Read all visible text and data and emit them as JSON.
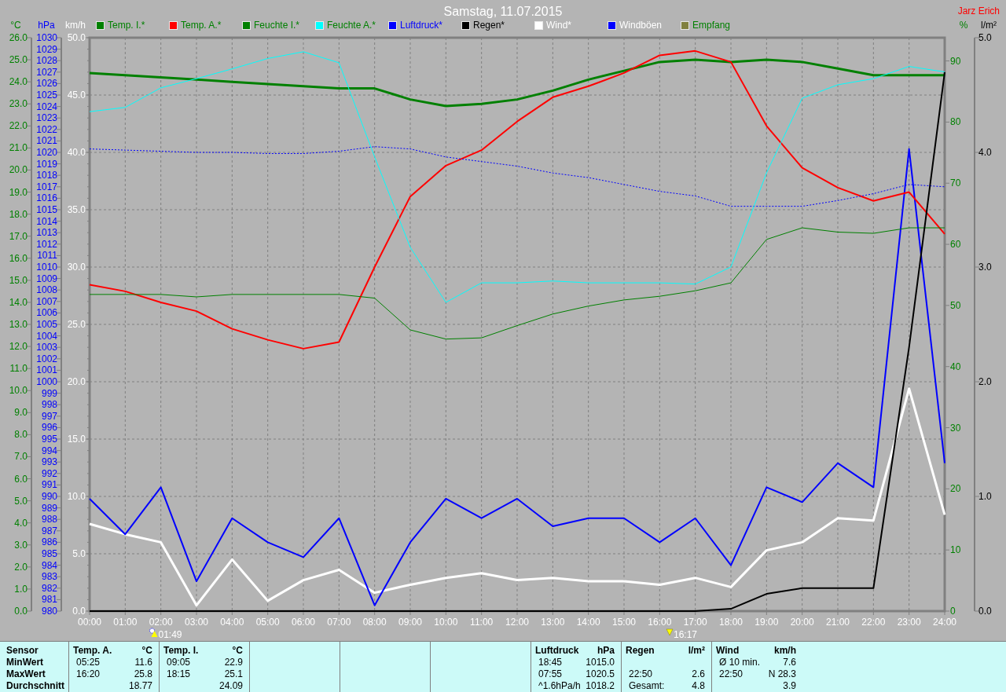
{
  "header": {
    "title": "Samstag, 11.07.2015",
    "user": "Jarz Erich"
  },
  "charts": [
    {
      "chart_data": {
        "type": "line",
        "ylabel": "km/h",
        "grid": true,
        "x": [
          0,
          1,
          2,
          3,
          4,
          5,
          6,
          7,
          8,
          9,
          10,
          11,
          12,
          13,
          14,
          15,
          16,
          17,
          18,
          19,
          20,
          21,
          22,
          23,
          24
        ],
        "xlim": [
          0,
          24
        ],
        "xticks": [
          {
            "value": 0,
            "label": "00:00"
          },
          {
            "value": 1,
            "label": "01:00"
          },
          {
            "value": 2,
            "label": "02:00"
          },
          {
            "value": 3,
            "label": "03:00"
          },
          {
            "value": 4,
            "label": "04:00"
          },
          {
            "value": 5,
            "label": "05:00"
          },
          {
            "value": 6,
            "label": "06:00"
          },
          {
            "value": 7,
            "label": "07:00"
          },
          {
            "value": 8,
            "label": "08:00"
          },
          {
            "value": 9,
            "label": "09:00"
          },
          {
            "value": 10,
            "label": "10:00"
          },
          {
            "value": 11,
            "label": "11:00"
          },
          {
            "value": 12,
            "label": "12:00"
          },
          {
            "value": 13,
            "label": "13:00"
          },
          {
            "value": 14,
            "label": "14:00"
          },
          {
            "value": 15,
            "label": "15:00"
          },
          {
            "value": 16,
            "label": "16:00"
          },
          {
            "value": 17,
            "label": "17:00"
          },
          {
            "value": 18,
            "label": "18:00"
          },
          {
            "value": 19,
            "label": "19:00"
          },
          {
            "value": 20,
            "label": "20:00"
          },
          {
            "value": 21,
            "label": "21:00"
          },
          {
            "value": 22,
            "label": "22:00"
          },
          {
            "value": 23,
            "label": "23:00"
          },
          {
            "value": 24,
            "label": "24:00"
          }
        ],
        "ylim": [
          0,
          50
        ],
        "yticks": [
          {
            "value": 50,
            "label": "50.0"
          },
          {
            "value": 45,
            "label": "45.0"
          },
          {
            "value": 40,
            "label": "40.0"
          },
          {
            "value": 35,
            "label": "35.0"
          },
          {
            "value": 30,
            "label": "30.0"
          },
          {
            "value": 25,
            "label": "25.0"
          },
          {
            "value": 20,
            "label": "20.0"
          },
          {
            "value": 15,
            "label": "15.0"
          },
          {
            "value": 10,
            "label": "10.0"
          },
          {
            "value": 5,
            "label": "5.0"
          },
          {
            "value": 0,
            "label": "0.0"
          }
        ],
        "series": [
          {
            "name": "Wind*",
            "color": "#ffffff",
            "values": [
              7.6,
              6.7,
              6.0,
              0.5,
              4.5,
              0.9,
              2.7,
              3.6,
              1.6,
              2.3,
              2.9,
              3.3,
              2.7,
              2.9,
              2.6,
              2.6,
              2.3,
              2.9,
              2.1,
              5.3,
              6.0,
              8.1,
              7.9,
              19.4,
              8.4
            ]
          },
          {
            "name": "Windböen",
            "color": "#0000ff",
            "values": [
              9.8,
              6.7,
              10.8,
              2.6,
              8.1,
              6.0,
              4.7,
              8.1,
              0.5,
              6.0,
              9.8,
              8.1,
              9.8,
              7.4,
              8.1,
              8.1,
              6.0,
              8.1,
              4.0,
              10.8,
              9.5,
              12.9,
              10.8,
              40.3,
              12.9
            ]
          }
        ]
      }
    },
    {
      "chart_data": {
        "type": "line",
        "ylabel": "°C",
        "x": [
          0,
          1,
          2,
          3,
          4,
          5,
          6,
          7,
          8,
          9,
          10,
          11,
          12,
          13,
          14,
          15,
          16,
          17,
          18,
          19,
          20,
          21,
          22,
          23,
          24
        ],
        "xlim": [
          0,
          24
        ],
        "ylim": [
          0,
          26
        ],
        "yticks": [
          {
            "value": 26,
            "label": "26.0"
          },
          {
            "value": 25,
            "label": "25.0"
          },
          {
            "value": 24,
            "label": "24.0"
          },
          {
            "value": 23,
            "label": "23.0"
          },
          {
            "value": 22,
            "label": "22.0"
          },
          {
            "value": 21,
            "label": "21.0"
          },
          {
            "value": 20,
            "label": "20.0"
          },
          {
            "value": 19,
            "label": "19.0"
          },
          {
            "value": 18,
            "label": "18.0"
          },
          {
            "value": 17,
            "label": "17.0"
          },
          {
            "value": 16,
            "label": "16.0"
          },
          {
            "value": 15,
            "label": "15.0"
          },
          {
            "value": 14,
            "label": "14.0"
          },
          {
            "value": 13,
            "label": "13.0"
          },
          {
            "value": 12,
            "label": "12.0"
          },
          {
            "value": 11,
            "label": "11.0"
          },
          {
            "value": 10,
            "label": "10.0"
          },
          {
            "value": 9,
            "label": "9.0"
          },
          {
            "value": 8,
            "label": "8.0"
          },
          {
            "value": 7,
            "label": "7.0"
          },
          {
            "value": 6,
            "label": "6.0"
          },
          {
            "value": 5,
            "label": "5.0"
          },
          {
            "value": 4,
            "label": "4.0"
          },
          {
            "value": 3,
            "label": "3.0"
          },
          {
            "value": 2,
            "label": "2.0"
          },
          {
            "value": 1,
            "label": "1.0"
          },
          {
            "value": 0,
            "label": "0.0"
          }
        ],
        "series": [
          {
            "name": "Temp. I.*",
            "color": "#008000",
            "values": [
              24.4,
              24.3,
              24.2,
              24.1,
              24.0,
              23.9,
              23.8,
              23.7,
              23.7,
              23.2,
              22.9,
              23.0,
              23.2,
              23.6,
              24.1,
              24.5,
              24.9,
              25.0,
              24.9,
              25.0,
              24.9,
              24.6,
              24.3,
              24.3,
              24.3
            ]
          },
          {
            "name": "Temp. A.*",
            "color": "#ff0000",
            "values": [
              14.8,
              14.5,
              14.0,
              13.6,
              12.8,
              12.3,
              11.9,
              12.2,
              15.6,
              18.8,
              20.2,
              20.9,
              22.2,
              23.3,
              23.8,
              24.4,
              25.2,
              25.4,
              24.9,
              22.0,
              20.1,
              19.2,
              18.6,
              19.0,
              17.1
            ]
          }
        ]
      }
    },
    {
      "chart_data": {
        "type": "line",
        "ylabel": "hPa",
        "x": [
          0,
          1,
          2,
          3,
          4,
          5,
          6,
          7,
          8,
          9,
          10,
          11,
          12,
          13,
          14,
          15,
          16,
          17,
          18,
          19,
          20,
          21,
          22,
          23,
          24
        ],
        "xlim": [
          0,
          24
        ],
        "ylim": [
          980,
          1030
        ],
        "yticks": [
          {
            "value": 1030,
            "label": "1030"
          },
          {
            "value": 1029,
            "label": "1029"
          },
          {
            "value": 1028,
            "label": "1028"
          },
          {
            "value": 1027,
            "label": "1027"
          },
          {
            "value": 1026,
            "label": "1026"
          },
          {
            "value": 1025,
            "label": "1025"
          },
          {
            "value": 1024,
            "label": "1024"
          },
          {
            "value": 1023,
            "label": "1023"
          },
          {
            "value": 1022,
            "label": "1022"
          },
          {
            "value": 1021,
            "label": "1021"
          },
          {
            "value": 1020,
            "label": "1020"
          },
          {
            "value": 1019,
            "label": "1019"
          },
          {
            "value": 1018,
            "label": "1018"
          },
          {
            "value": 1017,
            "label": "1017"
          },
          {
            "value": 1016,
            "label": "1016"
          },
          {
            "value": 1015,
            "label": "1015"
          },
          {
            "value": 1014,
            "label": "1014"
          },
          {
            "value": 1013,
            "label": "1013"
          },
          {
            "value": 1012,
            "label": "1012"
          },
          {
            "value": 1011,
            "label": "1011"
          },
          {
            "value": 1010,
            "label": "1010"
          },
          {
            "value": 1009,
            "label": "1009"
          },
          {
            "value": 1008,
            "label": "1008"
          },
          {
            "value": 1007,
            "label": "1007"
          },
          {
            "value": 1006,
            "label": "1006"
          },
          {
            "value": 1005,
            "label": "1005"
          },
          {
            "value": 1004,
            "label": "1004"
          },
          {
            "value": 1003,
            "label": "1003"
          },
          {
            "value": 1002,
            "label": "1002"
          },
          {
            "value": 1001,
            "label": "1001"
          },
          {
            "value": 1000,
            "label": "1000"
          },
          {
            "value": 999,
            "label": "999"
          },
          {
            "value": 998,
            "label": "998"
          },
          {
            "value": 997,
            "label": "997"
          },
          {
            "value": 996,
            "label": "996"
          },
          {
            "value": 995,
            "label": "995"
          },
          {
            "value": 994,
            "label": "994"
          },
          {
            "value": 993,
            "label": "993"
          },
          {
            "value": 992,
            "label": "992"
          },
          {
            "value": 991,
            "label": "991"
          },
          {
            "value": 990,
            "label": "990"
          },
          {
            "value": 989,
            "label": "989"
          },
          {
            "value": 988,
            "label": "988"
          },
          {
            "value": 987,
            "label": "987"
          },
          {
            "value": 986,
            "label": "986"
          },
          {
            "value": 985,
            "label": "985"
          },
          {
            "value": 984,
            "label": "984"
          },
          {
            "value": 983,
            "label": "983"
          },
          {
            "value": 982,
            "label": "982"
          },
          {
            "value": 981,
            "label": "981"
          },
          {
            "value": 980,
            "label": "980"
          }
        ],
        "series": [
          {
            "name": "Luftdruck*",
            "color": "#0000ff",
            "line_style": "dotted",
            "values": [
              1020.3,
              1020.2,
              1020.1,
              1020.0,
              1020.0,
              1019.9,
              1019.9,
              1020.1,
              1020.5,
              1020.3,
              1019.6,
              1019.2,
              1018.8,
              1018.2,
              1017.8,
              1017.2,
              1016.6,
              1016.2,
              1015.3,
              1015.3,
              1015.3,
              1015.8,
              1016.4,
              1017.2,
              1017.0
            ]
          }
        ]
      }
    },
    {
      "chart_data": {
        "type": "line",
        "ylabel": "%",
        "x": [
          0,
          1,
          2,
          3,
          4,
          5,
          6,
          7,
          8,
          9,
          10,
          11,
          12,
          13,
          14,
          15,
          16,
          17,
          18,
          19,
          20,
          21,
          22,
          23,
          24
        ],
        "xlim": [
          0,
          24
        ],
        "ylim": [
          0,
          93.8
        ],
        "yticks": [
          {
            "value": 90,
            "label": "90"
          },
          {
            "value": 80,
            "label": "80"
          },
          {
            "value": 70,
            "label": "70"
          },
          {
            "value": 60,
            "label": "60"
          },
          {
            "value": 50,
            "label": "50"
          },
          {
            "value": 40,
            "label": "40"
          },
          {
            "value": 30,
            "label": "30"
          },
          {
            "value": 20,
            "label": "20"
          },
          {
            "value": 10,
            "label": "10"
          },
          {
            "value": 0,
            "label": "0"
          }
        ],
        "series": [
          {
            "name": "Feuchte I.*",
            "color": "#008000",
            "values": [
              51.8,
              51.8,
              51.8,
              51.4,
              51.8,
              51.8,
              51.8,
              51.8,
              51.2,
              46.0,
              44.5,
              44.7,
              46.7,
              48.6,
              49.9,
              50.9,
              51.5,
              52.4,
              53.7,
              60.8,
              62.7,
              62.0,
              61.8,
              62.7,
              62.7
            ]
          },
          {
            "name": "Feuchte A.*",
            "color": "#00ffff",
            "values": [
              81.7,
              82.4,
              85.6,
              87.1,
              88.7,
              90.4,
              91.5,
              89.7,
              74.3,
              59.5,
              50.5,
              53.7,
              53.7,
              54.0,
              53.7,
              53.7,
              53.7,
              53.5,
              56.3,
              71.7,
              83.9,
              86.1,
              87.1,
              89.1,
              88.2
            ]
          }
        ]
      }
    },
    {
      "chart_data": {
        "type": "line",
        "ylabel": "l/m²",
        "x": [
          0,
          1,
          2,
          3,
          4,
          5,
          6,
          7,
          8,
          9,
          10,
          11,
          12,
          13,
          14,
          15,
          16,
          17,
          18,
          19,
          20,
          21,
          22,
          23,
          24
        ],
        "xlim": [
          0,
          24
        ],
        "ylim": [
          0,
          5
        ],
        "yticks": [
          {
            "value": 5,
            "label": "5.0"
          },
          {
            "value": 4,
            "label": "4.0"
          },
          {
            "value": 3,
            "label": "3.0"
          },
          {
            "value": 2,
            "label": "2.0"
          },
          {
            "value": 1,
            "label": "1.0"
          },
          {
            "value": 0,
            "label": "0.0"
          }
        ],
        "series": [
          {
            "name": "Regen*",
            "color": "#000000",
            "values": [
              0,
              0,
              0,
              0,
              0,
              0,
              0,
              0,
              0,
              0,
              0,
              0,
              0,
              0,
              0,
              0,
              0,
              0,
              0.02,
              0.15,
              0.2,
              0.2,
              0.2,
              2.3,
              4.7
            ]
          }
        ]
      }
    }
  ],
  "legend_extra": {
    "label": "Empfang",
    "color": "#808040"
  },
  "time_marks": [
    {
      "kind": "sun",
      "label": "01:49"
    },
    {
      "kind": "arrow",
      "label": "16:17"
    }
  ],
  "stats": {
    "labels": [
      "Sensor",
      "MinWert",
      "MaxWert",
      "Durchschnitt"
    ],
    "blocks": [
      {
        "kind": "data",
        "heading": "Temp. A.",
        "unit": "°C",
        "rows": [
          {
            "time": "05:25",
            "value": "11.6"
          },
          {
            "time": "16:20",
            "value": "25.8"
          },
          {
            "value": "18.77"
          }
        ]
      },
      {
        "kind": "data",
        "heading": "Temp. I.",
        "unit": "°C",
        "rows": [
          {
            "time": "09:05",
            "value": "22.9"
          },
          {
            "time": "18:15",
            "value": "25.1"
          },
          {
            "value": "24.09"
          }
        ]
      },
      {
        "kind": "empty"
      },
      {
        "kind": "empty"
      },
      {
        "kind": "empty"
      },
      {
        "kind": "data",
        "heading": "Luftdruck",
        "unit": "hPa",
        "rows": [
          {
            "time": "18:45",
            "value": "1015.0"
          },
          {
            "time": "07:55",
            "value": "1020.5"
          },
          {
            "time": "^1.6hPa/h",
            "value": "1018.2"
          }
        ]
      },
      {
        "kind": "data",
        "heading": "Regen",
        "unit": "l/m²",
        "rows": [
          {},
          {
            "time": "22:50",
            "value": "2.6"
          },
          {
            "time": "Gesamt:",
            "value": "4.8"
          }
        ]
      },
      {
        "kind": "data",
        "heading": "Wind",
        "unit": "km/h",
        "rows": [
          {
            "time": "Ø 10 min.",
            "value": "7.6"
          },
          {
            "time": "22:50",
            "value": "N 28.3"
          },
          {
            "value": "3.9"
          }
        ]
      }
    ]
  }
}
